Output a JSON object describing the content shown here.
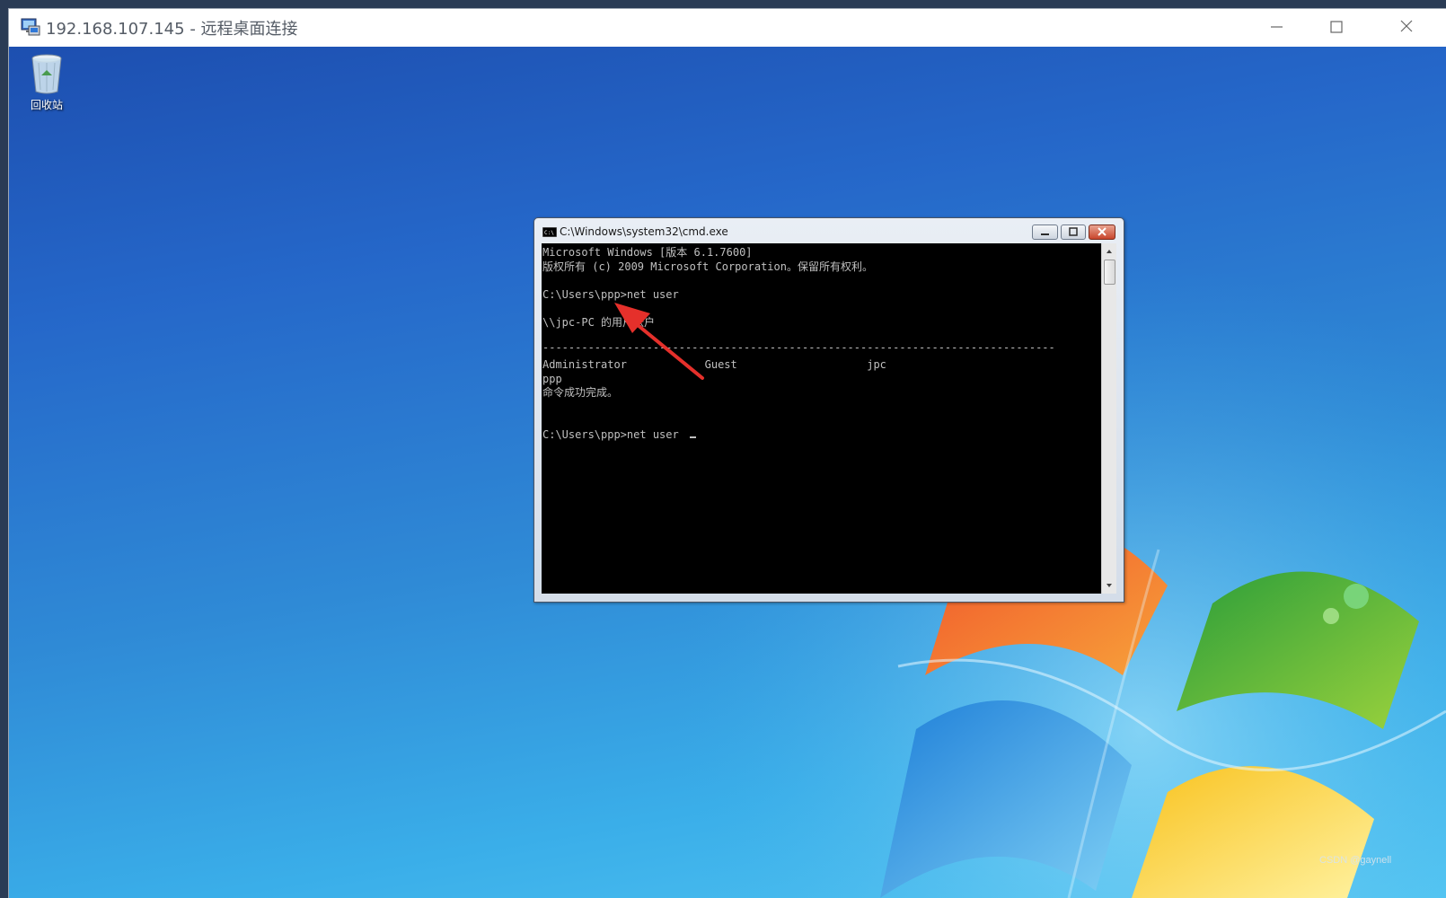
{
  "rdp": {
    "title": "192.168.107.145 - 远程桌面连接",
    "controls": [
      "minimize-icon",
      "maximize-icon",
      "close-icon"
    ]
  },
  "desktop": {
    "icons": [
      {
        "label": "回收站",
        "icon": "recycle-bin-icon"
      }
    ],
    "watermark": "CSDN @gaynell"
  },
  "cmd": {
    "title": "C:\\Windows\\system32\\cmd.exe",
    "lines": [
      "Microsoft Windows [版本 6.1.7600]",
      "版权所有 (c) 2009 Microsoft Corporation。保留所有权利。",
      "",
      "C:\\Users\\ppp>net user",
      "",
      "\\\\jpc-PC 的用户帐户",
      "",
      "-------------------------------------------------------------------------------",
      "Administrator            Guest                    jpc",
      "ppp",
      "命令成功完成。",
      "",
      "",
      "C:\\Users\\ppp>net user"
    ]
  },
  "colors": {
    "accent_arrow": "#e5302b",
    "console_bg": "#000000",
    "console_fg": "#c0c0c0"
  }
}
